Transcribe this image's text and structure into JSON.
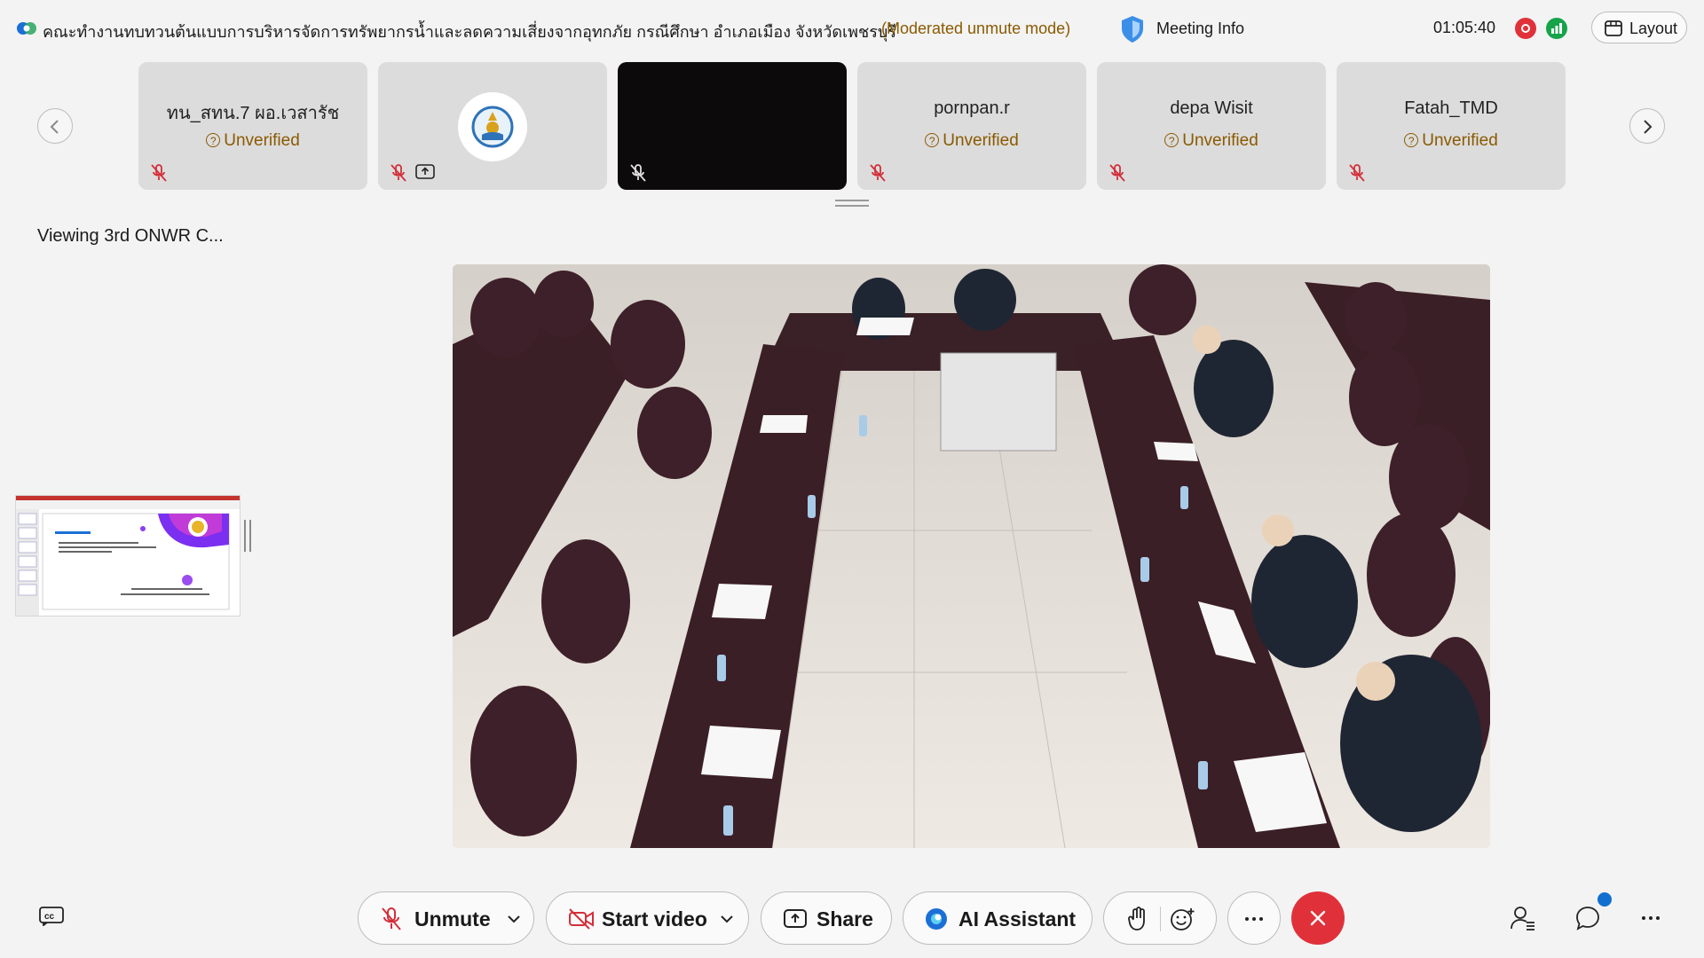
{
  "header": {
    "meeting_title": "คณะทำงานทบทวนต้นแบบการบริหารจัดการทรัพยากรน้ำและลดความเสี่ยงจากอุทกภัย กรณีศึกษา อำเภอเมือง จังหวัดเพชรบุรี",
    "mode": "(Moderated unmute mode)",
    "meeting_info_label": "Meeting Info",
    "elapsed_time": "01:05:40",
    "layout_label": "Layout"
  },
  "participants": [
    {
      "name": "ทน_สทน.7 ผอ.เวสารัช",
      "status": "Unverified"
    },
    {
      "name": "",
      "status": ""
    },
    {
      "name": "",
      "status": ""
    },
    {
      "name": "pornpan.r",
      "status": "Unverified"
    },
    {
      "name": "depa Wisit",
      "status": "Unverified"
    },
    {
      "name": "Fatah_TMD",
      "status": "Unverified"
    }
  ],
  "stage": {
    "viewing_label": "Viewing 3rd ONWR C..."
  },
  "controls": {
    "unmute_label": "Unmute",
    "start_video_label": "Start video",
    "share_label": "Share",
    "ai_assistant_label": "AI Assistant"
  },
  "colors": {
    "end_call": "#e0313a",
    "unverified_text": "#8a5a00",
    "recording": "#e0313a",
    "network": "#16a34a",
    "notification_badge": "#1170cf"
  },
  "icons": [
    "webex-logo-icon",
    "shield-icon",
    "recording-icon",
    "network-health-icon",
    "layout-icon",
    "chevron-left-icon",
    "chevron-right-icon",
    "muted-mic-icon",
    "share-screen-icon",
    "closed-captions-icon",
    "video-off-icon",
    "chevron-down-icon",
    "ai-assistant-icon",
    "raise-hand-icon",
    "reactions-icon",
    "more-icon",
    "close-icon",
    "participants-icon",
    "chat-icon"
  ]
}
